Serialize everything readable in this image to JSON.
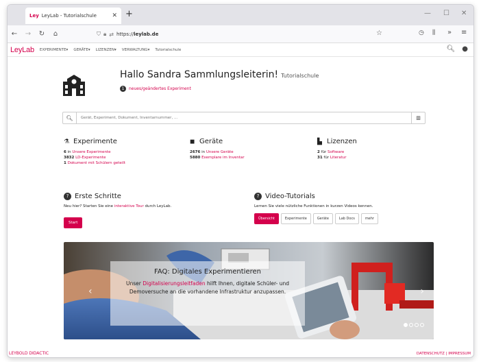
{
  "browser": {
    "tab_title": "LeyLab - Tutorialschule",
    "url_prefix": "https://",
    "url_host": "leylab.de"
  },
  "app": {
    "logo": "LeyLab",
    "menu": [
      "EXPERIMENTE",
      "GERÄTE",
      "LIZENZEN",
      "VERWALTUNG"
    ],
    "menu_plain": "Tutorialschule"
  },
  "hero": {
    "greeting": "Hallo Sandra Sammlungsleiterin!",
    "school": "Tutorialschule",
    "news_count": "1",
    "news_text": "neues/geändertes Experiment"
  },
  "search": {
    "placeholder": "Gerät, Experiment, Dokument, Inventarnummer, ..."
  },
  "experimente": {
    "title": "Experimente",
    "l1_num": "6",
    "l1_pre": "in",
    "l1_link": "Unsere Experimente",
    "l2_num": "3832",
    "l2_link": "LD-Experimente",
    "l3_num": "1",
    "l3_link": "Dokument mit Schülern geteilt"
  },
  "geraete": {
    "title": "Geräte",
    "l1_num": "2676",
    "l1_pre": "in",
    "l1_link": "Unsere Geräte",
    "l2_num": "5880",
    "l2_link": "Exemplare im Inventar"
  },
  "lizenzen": {
    "title": "Lizenzen",
    "l1_num": "2",
    "l1_pre": "für",
    "l1_link": "Software",
    "l2_num": "31",
    "l2_pre": "für",
    "l2_link": "Literatur"
  },
  "erste_schritte": {
    "title": "Erste Schritte",
    "text_pre": "Neu hier? Starten Sie eine",
    "text_link": "interaktive Tour",
    "text_post": "durch LeyLab.",
    "button": "Start"
  },
  "video": {
    "title": "Video-Tutorials",
    "text": "Lernen Sie viele nützliche Funktionen in kurzen Videos kennen.",
    "buttons": [
      "Übersicht",
      "Experimente",
      "Geräte",
      "Lab Docs",
      "mehr"
    ]
  },
  "carousel": {
    "title": "FAQ: Digitales Experimentieren",
    "pre": "Unser",
    "link": "Digitalisierungsleitfaden",
    "post": "hilft Ihnen, digitale Schüler- und Demoversuche an die vorhandene Infrastruktur anzupassen."
  },
  "footer": {
    "left": "LEYBOLD DIDACTIC",
    "right": "DATENSCHUTZ | IMPRESSUM"
  },
  "colors": {
    "accent": "#d4004c"
  }
}
